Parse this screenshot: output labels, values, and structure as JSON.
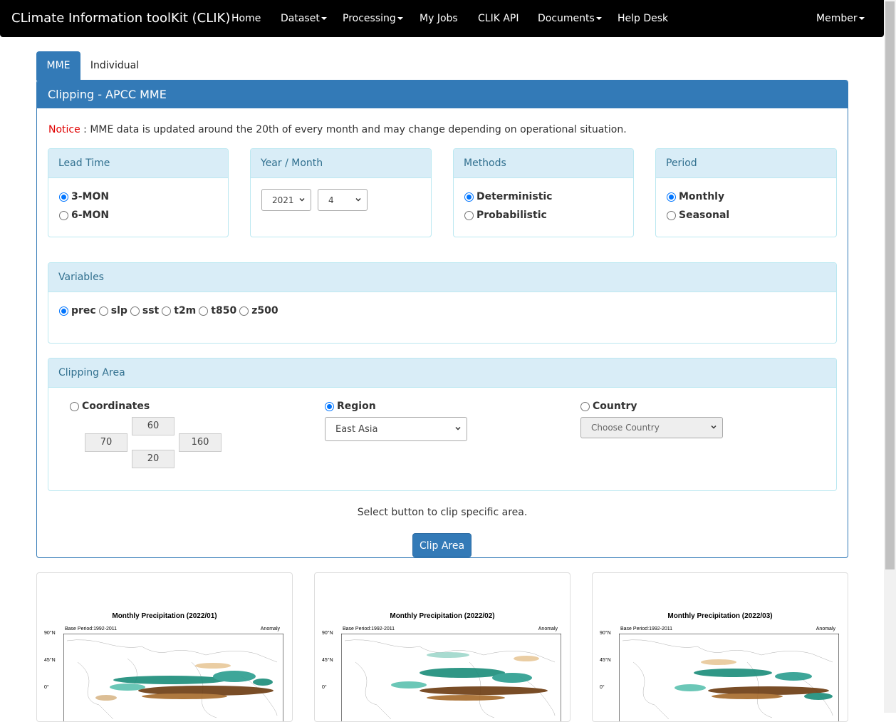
{
  "navbar": {
    "brand": "CLimate Information toolKit (CLIK)",
    "items": [
      {
        "label": "Home",
        "dropdown": false
      },
      {
        "label": "Dataset",
        "dropdown": true
      },
      {
        "label": "Processing",
        "dropdown": true
      },
      {
        "label": "My Jobs",
        "dropdown": false
      },
      {
        "label": "CLIK API",
        "dropdown": false
      },
      {
        "label": "Documents",
        "dropdown": true
      },
      {
        "label": "Help Desk",
        "dropdown": false
      }
    ],
    "member": {
      "label": "Member",
      "dropdown": true
    }
  },
  "tabs": [
    {
      "label": "MME",
      "active": true
    },
    {
      "label": "Individual",
      "active": false
    }
  ],
  "panel": {
    "title": "Clipping - APCC MME",
    "notice_label": "Notice",
    "notice_text": " : MME data is updated around the 20th of every month and may change depending on operational situation.",
    "lead_time": {
      "heading": "Lead Time",
      "options": [
        {
          "label": "3-MON",
          "checked": true
        },
        {
          "label": "6-MON",
          "checked": false
        }
      ]
    },
    "year_month": {
      "heading": "Year / Month",
      "year": "2021",
      "month": "4"
    },
    "methods": {
      "heading": "Methods",
      "options": [
        {
          "label": "Deterministic",
          "checked": true
        },
        {
          "label": "Probabilistic",
          "checked": false
        }
      ]
    },
    "period": {
      "heading": "Period",
      "options": [
        {
          "label": "Monthly",
          "checked": true
        },
        {
          "label": "Seasonal",
          "checked": false
        }
      ]
    },
    "variables": {
      "heading": "Variables",
      "options": [
        {
          "label": "prec",
          "checked": true
        },
        {
          "label": "slp",
          "checked": false
        },
        {
          "label": "sst",
          "checked": false
        },
        {
          "label": "t2m",
          "checked": false
        },
        {
          "label": "t850",
          "checked": false
        },
        {
          "label": "z500",
          "checked": false
        }
      ]
    },
    "clipping_area": {
      "heading": "Clipping Area",
      "coordinates": {
        "label": "Coordinates",
        "checked": false,
        "north": "60",
        "west": "70",
        "east": "160",
        "south": "20"
      },
      "region": {
        "label": "Region",
        "checked": true,
        "value": "East Asia"
      },
      "country": {
        "label": "Country",
        "checked": false,
        "placeholder": "Choose Country"
      }
    },
    "helper_text": "Select button to clip specific area.",
    "clip_button": "Clip Area"
  },
  "thumbnails": [
    {
      "title": "Monthly  Precipitation (2022/01)",
      "base": "Base Period:1992-2011",
      "type": "Anomaly"
    },
    {
      "title": "Monthly  Precipitation (2022/02)",
      "base": "Base Period:1992-2011",
      "type": "Anomaly"
    },
    {
      "title": "Monthly  Precipitation (2022/03)",
      "base": "Base Period:1992-2011",
      "type": "Anomaly"
    }
  ],
  "lat_labels": [
    "90°N",
    "45°N",
    "0°"
  ],
  "colors": {
    "primary": "#337ab7",
    "navbar": "#000000",
    "info_bg": "#d9edf7",
    "info_text": "#31708f",
    "notice": "#e00000"
  }
}
